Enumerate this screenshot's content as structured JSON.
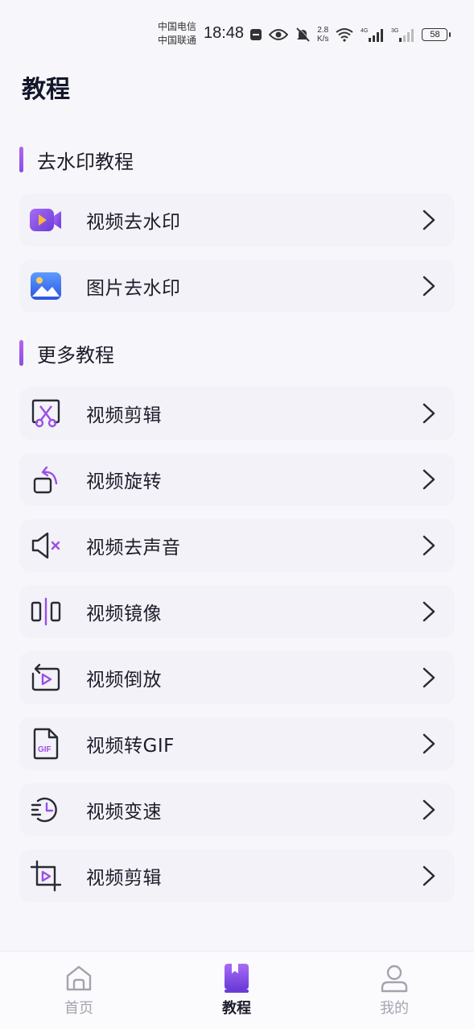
{
  "status_bar": {
    "carrier_1": "中国电信",
    "carrier_2": "中国联通",
    "time": "18:48",
    "net_speed_value": "2.8",
    "net_speed_unit": "K/s",
    "signal_1_type": "4G",
    "signal_2_type": "3G",
    "battery": "58"
  },
  "page": {
    "title": "教程"
  },
  "sections": [
    {
      "title": "去水印教程",
      "items": [
        {
          "label": "视频去水印",
          "icon": "video-camera-icon"
        },
        {
          "label": "图片去水印",
          "icon": "image-icon"
        }
      ]
    },
    {
      "title": "更多教程",
      "items": [
        {
          "label": "视频剪辑",
          "icon": "scissors-icon"
        },
        {
          "label": "视频旋转",
          "icon": "rotate-icon"
        },
        {
          "label": "视频去声音",
          "icon": "mute-icon"
        },
        {
          "label": "视频镜像",
          "icon": "mirror-icon"
        },
        {
          "label": "视频倒放",
          "icon": "reverse-play-icon"
        },
        {
          "label": "视频转GIF",
          "icon": "gif-file-icon"
        },
        {
          "label": "视频变速",
          "icon": "speed-clock-icon"
        },
        {
          "label": "视频剪辑",
          "icon": "crop-icon"
        }
      ]
    }
  ],
  "bottom_nav": {
    "items": [
      {
        "label": "首页",
        "icon": "home-icon",
        "active": false
      },
      {
        "label": "教程",
        "icon": "book-icon",
        "active": true
      },
      {
        "label": "我的",
        "icon": "user-icon",
        "active": false
      }
    ]
  },
  "colors": {
    "accent": "#8a4fe0",
    "accent_light": "#b466ef",
    "background": "#f7f7fb",
    "card": "#f3f2f8",
    "inactive": "#a4a4b0"
  }
}
